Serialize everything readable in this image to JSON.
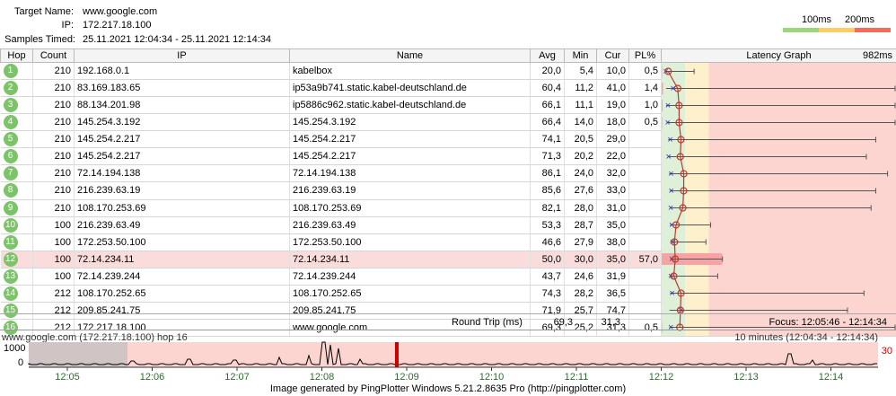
{
  "header": {
    "target_label": "Target Name:",
    "target_value": "www.google.com",
    "ip_label": "IP:",
    "ip_value": "172.217.18.100",
    "samples_label": "Samples Timed:",
    "samples_value": "25.11.2021 12:04:34 - 25.11.2021 12:14:34"
  },
  "legend": {
    "label_100": "100ms",
    "label_200": "200ms",
    "colors": [
      "#9bd67f",
      "#ffcc66",
      "#f26b5b"
    ]
  },
  "columns": {
    "hop": "Hop",
    "count": "Count",
    "ip": "IP",
    "name": "Name",
    "avg": "Avg",
    "min": "Min",
    "cur": "Cur",
    "pl": "PL%",
    "graph": "Latency Graph",
    "graph_max": "982ms"
  },
  "hops": [
    {
      "hop": "1",
      "count": "210",
      "ip": "192.168.0.1",
      "name": "kabelbox",
      "avg": "20,0",
      "min": "5,4",
      "cur": "10,0",
      "pl": "0,5"
    },
    {
      "hop": "2",
      "count": "210",
      "ip": "83.169.183.65",
      "name": "ip53a9b741.static.kabel-deutschland.de",
      "avg": "60,4",
      "min": "11,2",
      "cur": "41,0",
      "pl": "1,4"
    },
    {
      "hop": "3",
      "count": "210",
      "ip": "88.134.201.98",
      "name": "ip5886c962.static.kabel-deutschland.de",
      "avg": "66,1",
      "min": "11,1",
      "cur": "19,0",
      "pl": "1,0"
    },
    {
      "hop": "4",
      "count": "210",
      "ip": "145.254.3.192",
      "name": "145.254.3.192",
      "avg": "66,4",
      "min": "14,0",
      "cur": "18,0",
      "pl": "0,5"
    },
    {
      "hop": "5",
      "count": "210",
      "ip": "145.254.2.217",
      "name": "145.254.2.217",
      "avg": "74,1",
      "min": "20,5",
      "cur": "29,0",
      "pl": ""
    },
    {
      "hop": "6",
      "count": "210",
      "ip": "145.254.2.217",
      "name": "145.254.2.217",
      "avg": "71,3",
      "min": "20,2",
      "cur": "22,0",
      "pl": ""
    },
    {
      "hop": "7",
      "count": "210",
      "ip": "72.14.194.138",
      "name": "72.14.194.138",
      "avg": "86,1",
      "min": "24,0",
      "cur": "32,0",
      "pl": ""
    },
    {
      "hop": "8",
      "count": "210",
      "ip": "216.239.63.19",
      "name": "216.239.63.19",
      "avg": "85,6",
      "min": "27,6",
      "cur": "33,0",
      "pl": ""
    },
    {
      "hop": "9",
      "count": "210",
      "ip": "108.170.253.69",
      "name": "108.170.253.69",
      "avg": "82,1",
      "min": "28,0",
      "cur": "31,0",
      "pl": ""
    },
    {
      "hop": "10",
      "count": "100",
      "ip": "216.239.63.49",
      "name": "216.239.63.49",
      "avg": "53,3",
      "min": "28,7",
      "cur": "35,0",
      "pl": ""
    },
    {
      "hop": "11",
      "count": "100",
      "ip": "172.253.50.100",
      "name": "172.253.50.100",
      "avg": "46,6",
      "min": "27,9",
      "cur": "38,0",
      "pl": ""
    },
    {
      "hop": "12",
      "count": "100",
      "ip": "72.14.234.11",
      "name": "72.14.234.11",
      "avg": "50,0",
      "min": "30,0",
      "cur": "35,0",
      "pl": "57,0"
    },
    {
      "hop": "13",
      "count": "100",
      "ip": "72.14.239.244",
      "name": "72.14.239.244",
      "avg": "43,7",
      "min": "24,6",
      "cur": "31,9",
      "pl": ""
    },
    {
      "hop": "14",
      "count": "212",
      "ip": "108.170.252.65",
      "name": "108.170.252.65",
      "avg": "74,3",
      "min": "28,2",
      "cur": "36,5",
      "pl": ""
    },
    {
      "hop": "15",
      "count": "212",
      "ip": "209.85.241.75",
      "name": "209.85.241.75",
      "avg": "71,9",
      "min": "25,7",
      "cur": "74,7",
      "pl": ""
    },
    {
      "hop": "16",
      "count": "212",
      "ip": "172.217.18.100",
      "name": "www.google.com",
      "avg": "69,3",
      "min": "25,2",
      "cur": "31,3",
      "pl": "0,5"
    }
  ],
  "graph_max_ms": [
    130,
    1000,
    1000,
    1000,
    900,
    860,
    950,
    900,
    880,
    200,
    180,
    250,
    230,
    850,
    780,
    1000
  ],
  "roundtrip": {
    "label": "Round Trip (ms)",
    "avg": "69,3",
    "cur": "31,3",
    "focus": "Focus: 12:05:46 - 12:14:34"
  },
  "timeline": {
    "title": "www.google.com (172.217.18.100) hop 16",
    "range": "10 minutes (12:04:34 - 12:14:34)",
    "pl_max": "30",
    "y_top": "1000",
    "y_bot": "0",
    "ticks": [
      "12:05",
      "12:06",
      "12:07",
      "12:08",
      "12:09",
      "12:10",
      "12:11",
      "12:12",
      "12:13",
      "12:14"
    ]
  },
  "footer": "Image generated by PingPlotter Windows 5.21.2.8635 Pro (http://pingplotter.com)"
}
